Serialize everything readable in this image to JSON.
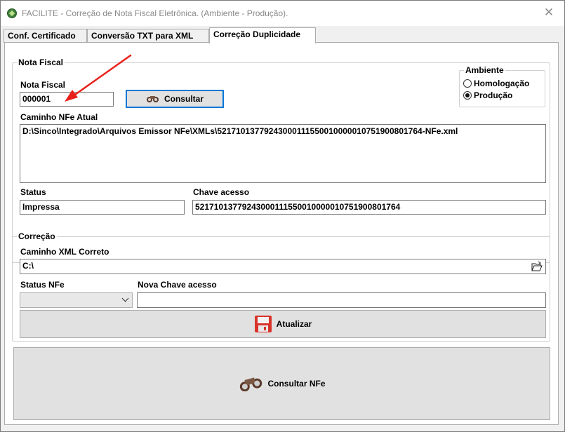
{
  "window": {
    "title": "FACILITE - Correção de Nota Fiscal Eletrônica. (Ambiente - Produção).",
    "close_glyph": "✕"
  },
  "tabs": [
    {
      "label": "Conf. Certificado",
      "active": false
    },
    {
      "label": "Conversão TXT para XML",
      "active": false
    },
    {
      "label": "Correção Duplicidade",
      "active": true
    }
  ],
  "nota_fiscal": {
    "group_title": "Nota Fiscal",
    "nf_label": "Nota Fiscal",
    "nf_value": "000001",
    "consultar_label": "Consultar",
    "caminho_label": "Caminho NFe Atual",
    "caminho_value": "D:\\Sinco\\Integrado\\Arquivos Emissor NFe\\XMLs\\52171013779243000111550010000010751900801764-NFe.xml",
    "status_label": "Status",
    "status_value": "Impressa",
    "chave_label": "Chave acesso",
    "chave_value": "52171013779243000111550010000010751900801764"
  },
  "ambiente": {
    "group_title": "Ambiente",
    "options": [
      {
        "label": "Homologação",
        "selected": false
      },
      {
        "label": "Produção",
        "selected": true
      }
    ]
  },
  "correcao": {
    "group_title": "Correção",
    "caminho_label": "Caminho XML Correto",
    "caminho_value": "C:\\",
    "status_nfe_label": "Status NFe",
    "status_nfe_value": "",
    "nova_chave_label": "Nova Chave acesso",
    "nova_chave_value": "",
    "atualizar_label": "Atualizar"
  },
  "consultar_nfe_label": "Consultar NFe",
  "colors": {
    "annotation_arrow": "#e8201a",
    "focus_border": "#0078d7",
    "save_icon": "#d9342b"
  }
}
